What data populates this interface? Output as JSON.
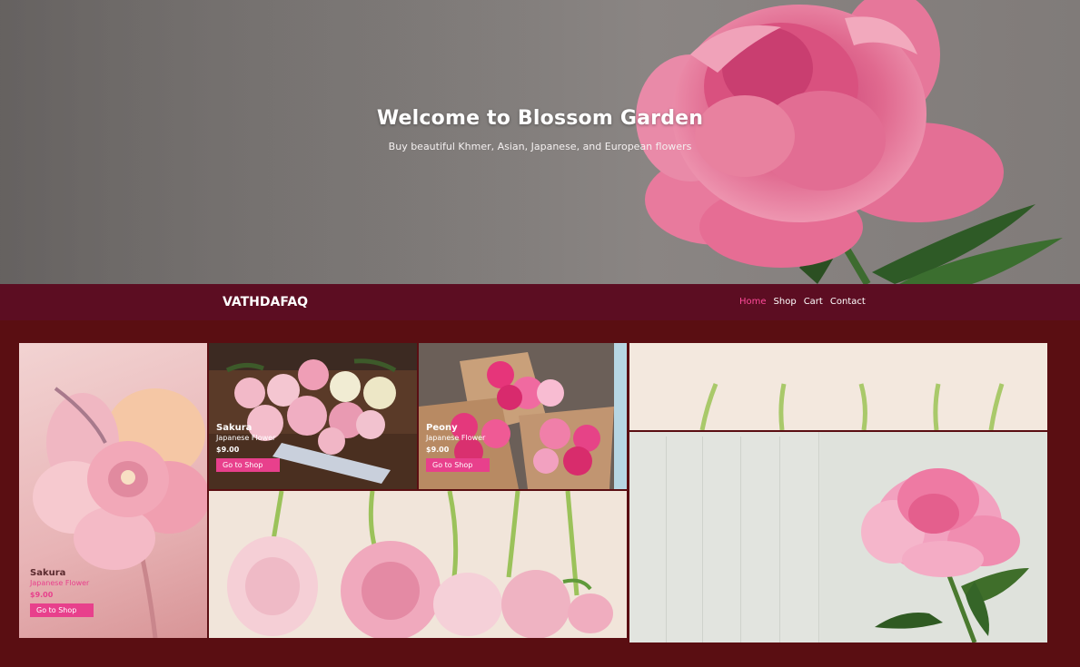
{
  "hero": {
    "title": "Welcome to Blossom Garden",
    "subtitle": "Buy beautiful Khmer, Asian, Japanese, and European flowers"
  },
  "nav": {
    "brand": "VATHDAFAQ",
    "links": [
      {
        "label": "Home",
        "active": true
      },
      {
        "label": "Shop",
        "active": false
      },
      {
        "label": "Cart",
        "active": false
      },
      {
        "label": "Contact",
        "active": false
      }
    ]
  },
  "cards": [
    {
      "name": "Sakura",
      "type": "Japanese Flower",
      "price": "$9.00",
      "button": "Go to Shop"
    },
    {
      "name": "Sakura",
      "type": "Japanese Flower",
      "price": "$9.00",
      "button": "Go to Shop"
    },
    {
      "name": "Peony",
      "type": "Japanese Flower",
      "price": "$9.00",
      "button": "Go to Shop"
    }
  ],
  "colors": {
    "background": "#5a0e12",
    "navbar": "#5c0d22",
    "accent": "#e8408c",
    "active_link": "#ff4b9b"
  }
}
